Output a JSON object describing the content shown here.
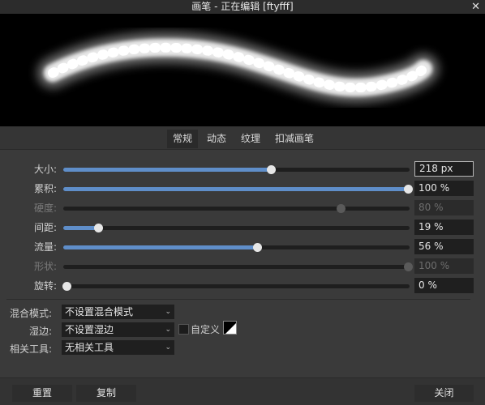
{
  "window": {
    "title": "画笔 - 正在编辑 [ftyfff]",
    "close_glyph": "✕"
  },
  "tabs": [
    "常规",
    "动态",
    "纹理",
    "扣减画笔"
  ],
  "active_tab": "常规",
  "sliders": [
    {
      "label": "大小:",
      "value": "218 px",
      "fraction": 0.6,
      "enabled": true
    },
    {
      "label": "累积:",
      "value": "100 %",
      "fraction": 0.995,
      "enabled": true
    },
    {
      "label": "硬度:",
      "value": "80 %",
      "fraction": 0.8,
      "enabled": false
    },
    {
      "label": "间距:",
      "value": "19 %",
      "fraction": 0.1,
      "enabled": true
    },
    {
      "label": "流量:",
      "value": "56 %",
      "fraction": 0.56,
      "enabled": true
    },
    {
      "label": "形状:",
      "value": "100 %",
      "fraction": 0.995,
      "enabled": false
    },
    {
      "label": "旋转:",
      "value": "0 %",
      "fraction": 0.01,
      "enabled": true
    }
  ],
  "blend": {
    "mode_label": "混合模式:",
    "mode_value": "不设置混合模式",
    "wet_label": "湿边:",
    "wet_value": "不设置湿边",
    "custom_label": "自定义",
    "tool_label": "相关工具:",
    "tool_value": "无相关工具"
  },
  "footer": {
    "reset": "重置",
    "copy": "复制",
    "close": "关闭"
  },
  "colors": {
    "accent": "#5f8ec9",
    "panel": "#3a3a3a"
  }
}
